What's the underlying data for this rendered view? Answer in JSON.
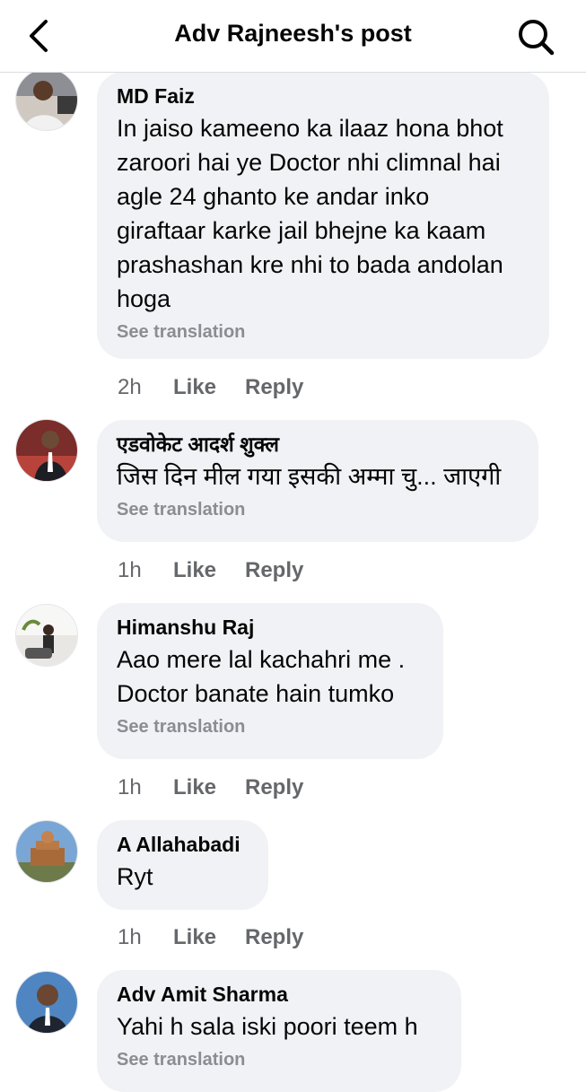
{
  "header": {
    "title": "Adv Rajneesh's post",
    "back_icon": "chevron-left-icon",
    "search_icon": "search-icon"
  },
  "comments": [
    {
      "author": "MD Faiz",
      "lines": [
        "In jaiso kameeno ka ilaaz hona bhot",
        "zaroori hai ye Doctor nhi climnal hai",
        "agle 24 ghanto ke andar inko",
        "giraftaar karke jail bhejne ka kaam",
        "prashashan kre nhi to bada andolan",
        "hoga"
      ],
      "see_translation": "See translation",
      "time": "2h",
      "like": "Like",
      "reply": "Reply"
    },
    {
      "author": "एडवोकेट आदर्श शुक्ल",
      "lines": [
        "जिस दिन मील गया इसकी अम्मा चु... जाएगी"
      ],
      "see_translation": "See translation",
      "time": "1h",
      "like": "Like",
      "reply": "Reply"
    },
    {
      "author": "Himanshu Raj",
      "lines": [
        "Aao mere lal kachahri me .",
        "Doctor banate hain tumko"
      ],
      "see_translation": "See translation",
      "time": "1h",
      "like": "Like",
      "reply": "Reply"
    },
    {
      "author": "A Allahabadi",
      "lines": [
        "Ryt"
      ],
      "time": "1h",
      "like": "Like",
      "reply": "Reply"
    },
    {
      "author": "Adv Amit Sharma",
      "lines": [
        "Yahi h sala iski poori teem h"
      ],
      "see_translation": "See translation"
    }
  ],
  "colors": {
    "bubble": "#f0f2f5",
    "muted_text": "#65676b",
    "translation_text": "#8a8d91",
    "divider": "#dcdde0"
  }
}
